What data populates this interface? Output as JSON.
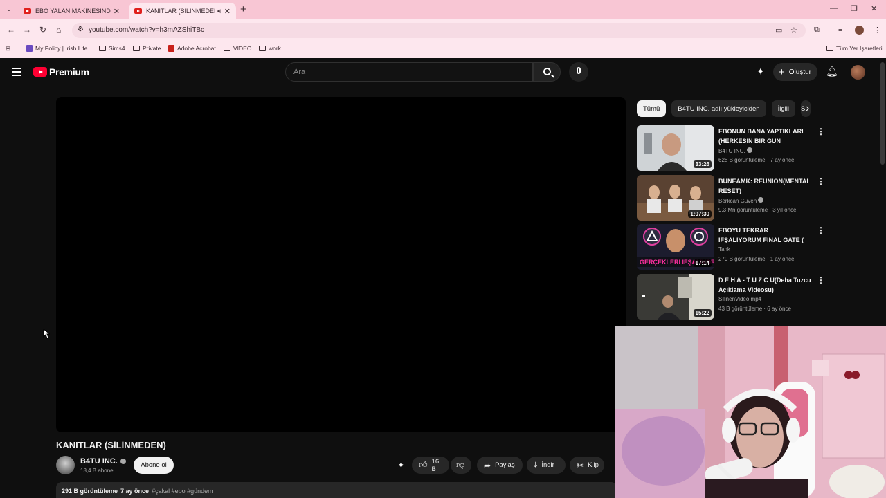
{
  "browser": {
    "tabs": [
      {
        "title": "EBO YALAN MAKİNESİNDE! | #",
        "close": "✕"
      },
      {
        "title": "KANITLAR (SİLİNMEDEN) -",
        "close": "✕"
      }
    ],
    "url": "youtube.com/watch?v=h3mAZShiTBc",
    "bookmarks": [
      "My Policy | Irish Life...",
      "Sims4",
      "Private",
      "Adobe Acrobat",
      "VIDEO",
      "work"
    ],
    "all_bookmarks": "Tüm Yer İşaretleri"
  },
  "youtube": {
    "logo_text": "Premium",
    "search_placeholder": "Ara",
    "create_label": "Oluştur"
  },
  "video": {
    "title": "KANITLAR (SİLİNMEDEN)",
    "channel": "B4TU INC.",
    "subscribers": "18,4 B abone",
    "subscribe_label": "Abone ol",
    "likes": "16 B",
    "share_label": "Paylaş",
    "download_label": "İndir",
    "clip_label": "Klip",
    "views": "291 B görüntüleme",
    "age": "7 ay önce",
    "tags": "#çakal #ebo #gündem"
  },
  "chips": [
    "Tümü",
    "B4TU INC. adlı yükleyiciden",
    "İlgili",
    "S"
  ],
  "recommendations": [
    {
      "title": "EBONUN BANA YAPTIKLARI (HERKESİN BİR GÜN MASKESİ...",
      "channel": "B4TU INC.",
      "meta": "628 B görüntüleme · 7 ay önce",
      "duration": "33:26"
    },
    {
      "title": "BUNEAMK: REUNION(MENTAL RESET)",
      "channel": "Berkcan Güven",
      "meta": "9,3 Mn görüntüleme · 3 yıl önce",
      "duration": "1:07:30"
    },
    {
      "title": "EBOYU TEKRAR İFŞALIYORUM FİNAL GATE ( SİLİNMEDEN İZ...",
      "channel": "Tank",
      "meta": "279 B görüntüleme · 1 ay önce",
      "duration": "17:14"
    },
    {
      "title": "D E H A - T U Z C U(Deha Tuzcu Açıklama Videosu)",
      "channel": "SilinenVideo.mp4",
      "meta": "43 B görüntüleme · 6 ay önce",
      "duration": "15:22"
    }
  ],
  "thumb_texts": {
    "rec3_overlay": "GERÇEKLERİ İFŞALIYORUM"
  },
  "colors": {
    "yt_red": "#ff0033",
    "bg": "#0f0f0f",
    "chrome_pink": "#f8c6d4"
  }
}
